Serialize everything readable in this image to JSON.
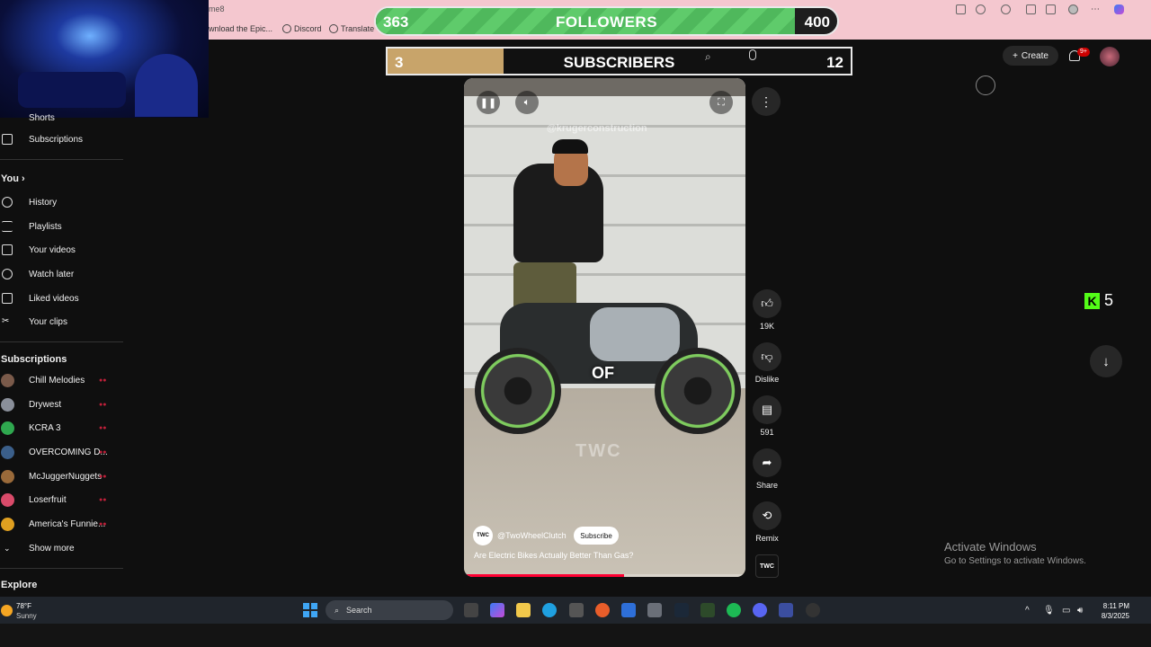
{
  "browser": {
    "url_fragment": "me8",
    "bookmarks": [
      "wnload the Epic...",
      "Discord",
      "Translate"
    ]
  },
  "overlay": {
    "followers": {
      "label": "FOLLOWERS",
      "current": "363",
      "goal": "400",
      "progress": 0.9075
    },
    "subscribers": {
      "label": "SUBSCRIBERS",
      "current": "3",
      "goal": "12",
      "progress": 0.25
    }
  },
  "header": {
    "create_label": "Create",
    "notification_badge": "9+"
  },
  "sidebar": {
    "shorts_label": "Shorts",
    "subscriptions_label": "Subscriptions",
    "you_heading": "You",
    "you_items": [
      {
        "label": "History",
        "icon": "history-icon"
      },
      {
        "label": "Playlists",
        "icon": "playlist-icon"
      },
      {
        "label": "Your videos",
        "icon": "video-icon"
      },
      {
        "label": "Watch later",
        "icon": "clock-icon"
      },
      {
        "label": "Liked videos",
        "icon": "thumbs-up-icon"
      },
      {
        "label": "Your clips",
        "icon": "scissors-icon"
      }
    ],
    "subscriptions_heading": "Subscriptions",
    "channels": [
      {
        "name": "Chill Melodies",
        "color": "#7a5a4a"
      },
      {
        "name": "Drywest",
        "color": "#8a8f9a"
      },
      {
        "name": "KCRA 3",
        "color": "#2fa84f"
      },
      {
        "name": "OVERCOMING D...",
        "color": "#3b5f8a"
      },
      {
        "name": "McJuggerNuggets",
        "color": "#9a6a3a"
      },
      {
        "name": "Loserfruit",
        "color": "#d94b6a"
      },
      {
        "name": "America's Funnie...",
        "color": "#e0a020"
      }
    ],
    "show_more_label": "Show more",
    "explore_heading": "Explore"
  },
  "video": {
    "watermark": "@krugerconstruction",
    "caption_word": "OF",
    "brand_watermark": "TWC",
    "channel_handle": "@TwoWheelClutch",
    "channel_avatar_text": "TWC",
    "subscribe_label": "Subscribe",
    "title": "Are Electric Bikes Actually Better Than Gas?",
    "progress": 0.57
  },
  "actions": {
    "likes": "19K",
    "dislike_label": "Dislike",
    "comments": "591",
    "share_label": "Share",
    "remix_label": "Remix"
  },
  "kick": {
    "count": "5"
  },
  "activate_windows": {
    "title": "Activate Windows",
    "subtitle": "Go to Settings to activate Windows."
  },
  "taskbar": {
    "weather_temp": "78°F",
    "weather_desc": "Sunny",
    "search_placeholder": "Search",
    "time": "8:11 PM",
    "date": "8/3/2025"
  }
}
